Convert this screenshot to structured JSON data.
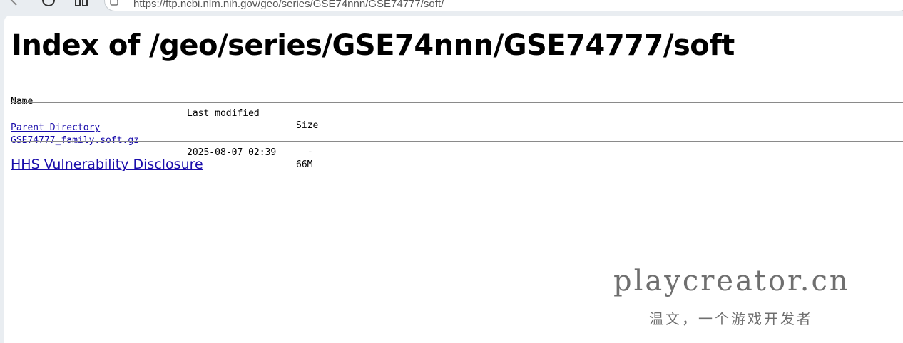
{
  "browser": {
    "url": "https://ftp.ncbi.nlm.nih.gov/geo/series/GSE74nnn/GSE74777/soft/"
  },
  "page": {
    "title": "Index of /geo/series/GSE74nnn/GSE74777/soft",
    "columns": {
      "name": "Name",
      "last_modified": "Last modified",
      "size": "Size"
    },
    "rows": [
      {
        "name": "Parent Directory",
        "modified": "",
        "size": "-"
      },
      {
        "name": "GSE74777_family.soft.gz",
        "modified": "2025-08-07 02:39",
        "size": "66M"
      }
    ],
    "footer_link": "HHS Vulnerability Disclosure"
  },
  "watermark": {
    "main": "playcreator.cn",
    "sub": "温文，一个游戏开发者"
  }
}
